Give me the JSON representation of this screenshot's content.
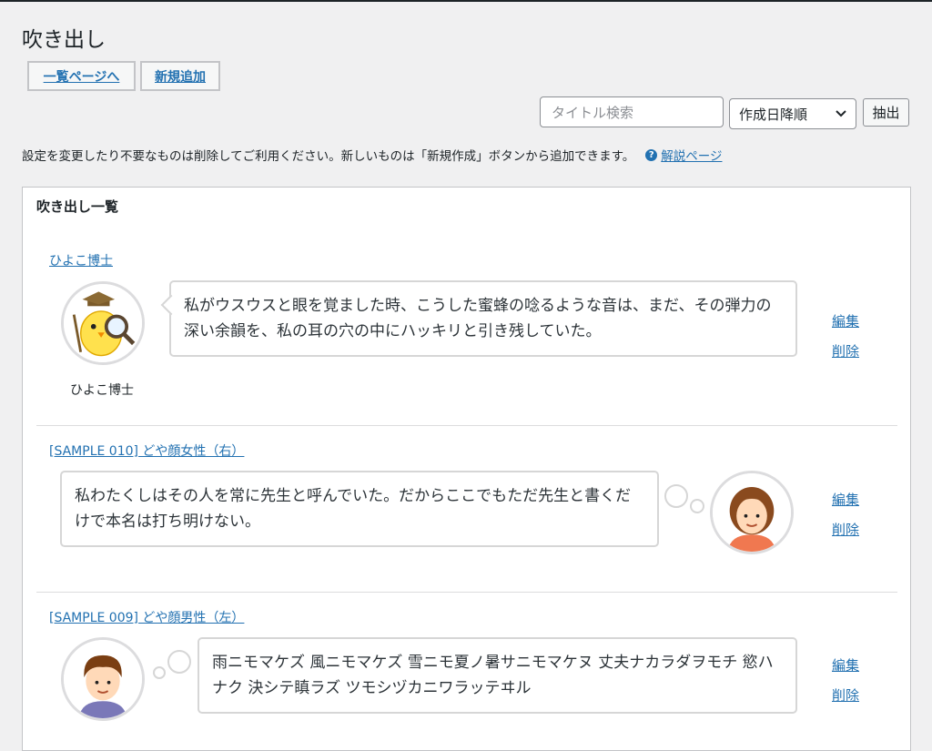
{
  "page": {
    "title": "吹き出し"
  },
  "nav": {
    "list_label": "一覧ページへ",
    "new_label": "新規追加"
  },
  "filter": {
    "search_placeholder": "タイトル検索",
    "sort_selected": "作成日降順",
    "submit_label": "抽出"
  },
  "description": {
    "text": "設定を変更したり不要なものは削除してご利用ください。新しいものは「新規作成」ボタンから追加できます。",
    "help_link": "解説ページ"
  },
  "panel": {
    "title": "吹き出し一覧"
  },
  "items": [
    {
      "title": "ひよこ博士",
      "avatar_name": "ひよこ博士",
      "style": "speech-left",
      "text": "私がウスウスと眼を覚ました時、こうした蜜蜂の唸るような音は、まだ、その弾力の深い余韻を、私の耳の穴の中にハッキリと引き残していた。",
      "edit": "編集",
      "delete": "削除"
    },
    {
      "title": "[SAMPLE 010] どや顔女性（右）",
      "avatar_name": "",
      "style": "think-right",
      "text": "私わたくしはその人を常に先生と呼んでいた。だからここでもただ先生と書くだけで本名は打ち明けない。",
      "edit": "編集",
      "delete": "削除"
    },
    {
      "title": "[SAMPLE 009] どや顔男性（左）",
      "avatar_name": "",
      "style": "think-left",
      "text": "雨ニモマケズ 風ニモマケズ 雪ニモ夏ノ暑サニモマケヌ 丈夫ナカラダヲモチ 慾ハナク 決シテ瞋ラズ ツモシヅカニワラッテヰル",
      "edit": "編集",
      "delete": "削除"
    }
  ],
  "colors": {
    "link": "#2271b1",
    "background": "#f0f0f1",
    "border": "#c3c4c7"
  }
}
